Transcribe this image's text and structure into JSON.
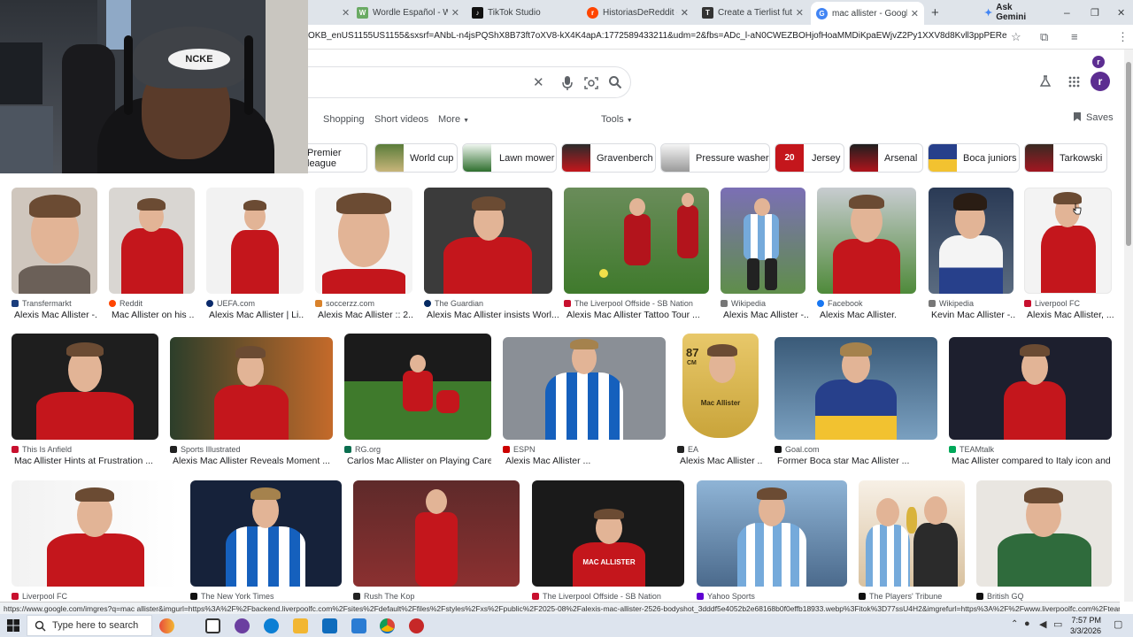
{
  "browser": {
    "tabs": [
      {
        "title": "Wordle Español - Wor",
        "icon": "wordle-icon",
        "color": "#6aaa64",
        "letter": "W"
      },
      {
        "title": "TikTok Studio",
        "icon": "tiktok-icon",
        "color": "#111111",
        "letter": "♪"
      },
      {
        "title": "HistoriasDeReddit - Un",
        "icon": "reddit-icon",
        "color": "#ff4500",
        "letter": "r"
      },
      {
        "title": "Create a Tierlist futbol",
        "icon": "tiermaker-icon",
        "color": "#333333",
        "letter": "T"
      },
      {
        "title": "mac allister - Google S",
        "icon": "google-icon",
        "color": "#4285f4",
        "letter": "G",
        "active": true
      }
    ],
    "new_tab": "+",
    "ask_gemini": "Ask Gemini",
    "url": "OKB_enUS1155US1155&sxsrf=ANbL-n4jsPQShX8B73ft7oXV8-kX4K4apA:1772589433211&udm=2&fbs=ADc_l-aN0CWEZBOHjofHoaMMDiKpaEWjvZ2Py1XXV8d8Kvll3ppPEReeCOS7s1VbbZz2...",
    "profile_initial": "r",
    "window_controls": {
      "minimize": "–",
      "restore": "❐",
      "close": "✕"
    }
  },
  "search": {
    "clear": "✕"
  },
  "filters": [
    "Shopping",
    "Short videos",
    "More",
    "Tools"
  ],
  "saves": "Saves",
  "chips": [
    {
      "label": "Premier league",
      "color": "#1d2b64"
    },
    {
      "label": "World cup",
      "color": "#5a7c3a"
    },
    {
      "label": "Lawn mower",
      "color": "#2f6f2e"
    },
    {
      "label": "Gravenberch",
      "color": "#c4161c"
    },
    {
      "label": "Pressure washer",
      "color": "#e6e6e6"
    },
    {
      "label": "Jersey",
      "color": "#c4161c"
    },
    {
      "label": "Arsenal",
      "color": "#b0141c"
    },
    {
      "label": "Boca juniors",
      "color": "#27408b"
    },
    {
      "label": "Tarkowski",
      "color": "#a31621"
    }
  ],
  "results": {
    "row1": [
      {
        "source": "Transfermarkt",
        "title": "Alexis Mac Allister -...",
        "fav": "#1a3d7c"
      },
      {
        "source": "Reddit",
        "title": "Mac Allister on his ...",
        "fav": "#ff4500"
      },
      {
        "source": "UEFA.com",
        "title": "Alexis Mac Allister | Li...",
        "fav": "#0a2a6b"
      },
      {
        "source": "soccerzz.com",
        "title": "Alexis Mac Allister :: 2...",
        "fav": "#d9822b"
      },
      {
        "source": "The Guardian",
        "title": "Alexis Mac Allister insists Worl...",
        "fav": "#052962"
      },
      {
        "source": "The Liverpool Offside - SB Nation",
        "title": "Alexis Mac Allister Tattoo Tour ...",
        "fav": "#c8102e"
      },
      {
        "source": "Wikipedia",
        "title": "Alexis Mac Allister -...",
        "fav": "#777777"
      },
      {
        "source": "Facebook",
        "title": "Alexis Mac Allister.",
        "fav": "#1877f2"
      },
      {
        "source": "Wikipedia",
        "title": "Kevin Mac Allister -...",
        "fav": "#777777"
      },
      {
        "source": "Liverpool FC",
        "title": "Alexis Mac Allister, ...",
        "fav": "#c8102e"
      }
    ],
    "row2": [
      {
        "source": "This Is Anfield",
        "title": "Mac Allister Hints at Frustration ...",
        "fav": "#c8102e"
      },
      {
        "source": "Sports Illustrated",
        "title": "Alexis Mac Allister Reveals Moment ...",
        "fav": "#222222"
      },
      {
        "source": "RG.org",
        "title": "Carlos Mac Allister on Playing Care...",
        "fav": "#0b6e4f"
      },
      {
        "source": "ESPN",
        "title": "Alexis Mac Allister ...",
        "fav": "#cc0000"
      },
      {
        "source": "EA",
        "title": "Alexis Mac Allister ...",
        "fav": "#222222"
      },
      {
        "source": "Goal.com",
        "title": "Former Boca star Mac Allister ...",
        "fav": "#111111"
      },
      {
        "source": "TEAMtalk",
        "title": "Mac Allister compared to Italy icon and ...",
        "fav": "#00a859"
      }
    ],
    "row3": [
      {
        "source": "Liverpool FC",
        "fav": "#c8102e"
      },
      {
        "source": "The New York Times",
        "fav": "#111111"
      },
      {
        "source": "Rush The Kop",
        "fav": "#222222"
      },
      {
        "source": "The Liverpool Offside - SB Nation",
        "fav": "#c8102e"
      },
      {
        "source": "Yahoo Sports",
        "fav": "#6001d2"
      },
      {
        "source": "The Players' Tribune",
        "fav": "#111111"
      },
      {
        "source": "British GQ",
        "fav": "#111111"
      }
    ],
    "card_text": {
      "rating": "87",
      "position": "CM",
      "name": "Mac Allister",
      "jersey_back": "MAC ALLISTER",
      "jersey_number": "20"
    }
  },
  "status_url": "https://www.google.com/imgres?q=mac allister&imgurl=https%3A%2F%2Fbackend.liverpoolfc.com%2Fsites%2Fdefault%2Ffiles%2Fstyles%2Fxs%2Fpublic%2F2025-08%2Falexis-mac-allister-2526-bodyshot_3dddf5e4052b2e68168b0f0effb18933.webp%3Fitok%3D77ssU4H2&imgrefurl=https%3A%2F%2Fwww.liverpoolfc.com%2Fteam%2Fmens%2Fplayer...",
  "taskbar": {
    "search_placeholder": "Type here to search",
    "time": "7:57 PM",
    "date": "3/3/2026",
    "apps": [
      "#e94d3c",
      "#6b3fa0",
      "#0c7fd4",
      "#f2b632",
      "#0f6cbd",
      "#2b7cd3",
      "#db4437",
      "#c62828"
    ]
  },
  "webcam": {
    "cap_text": "NCKE"
  }
}
